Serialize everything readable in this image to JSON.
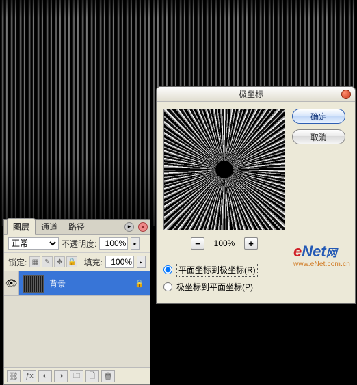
{
  "layers_panel": {
    "tabs": {
      "layers": "图层",
      "channels": "通道",
      "paths": "路径"
    },
    "blend_mode": "正常",
    "opacity_label": "不透明度:",
    "opacity_value": "100%",
    "lock_label": "锁定:",
    "fill_label": "填充:",
    "fill_value": "100%",
    "layer": {
      "name": "背景"
    }
  },
  "dialog": {
    "title": "极坐标",
    "ok": "确定",
    "cancel": "取消",
    "zoom_value": "100%",
    "zoom_minus": "−",
    "zoom_plus": "+",
    "option_rect_to_polar": "平面坐标到极坐标(R)",
    "option_polar_to_rect": "极坐标到平面坐标(P)"
  },
  "watermark": {
    "e": "e",
    "net": "Net",
    "tail": "网",
    "sub": "www.eNet.com.cn"
  }
}
